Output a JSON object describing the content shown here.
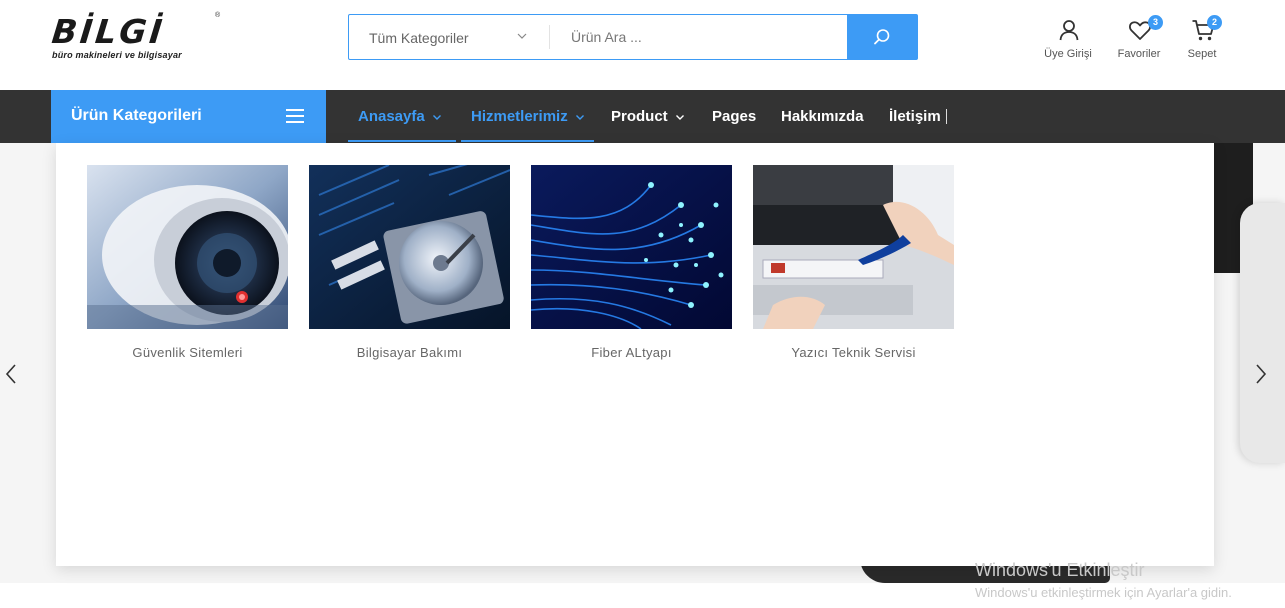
{
  "header": {
    "logo": {
      "word": "BİLGİ",
      "registered": "®",
      "tagline": "büro makineleri ve bilgisayar"
    },
    "search": {
      "category_label": "Tüm Kategoriler",
      "placeholder": "Ürün Ara ..."
    },
    "actions": [
      {
        "label": "Üye Girişi",
        "icon": "user-icon"
      },
      {
        "label": "Favoriler",
        "icon": "heart-icon",
        "badge": "3"
      },
      {
        "label": "Sepet",
        "icon": "cart-icon",
        "badge": "2"
      }
    ]
  },
  "nav": {
    "categories_label": "Ürün Kategorileri",
    "items": [
      {
        "label": "Anasayfa",
        "has_dropdown": true,
        "active": true
      },
      {
        "label": "Hizmetlerimiz",
        "has_dropdown": true,
        "active": true
      },
      {
        "label": "Product",
        "has_dropdown": true,
        "active": false
      },
      {
        "label": "Pages",
        "has_dropdown": false,
        "active": false
      },
      {
        "label": "Hakkımızda",
        "has_dropdown": false,
        "active": false
      },
      {
        "label": "İletişim",
        "has_dropdown": false,
        "active": false
      }
    ]
  },
  "dropdown": {
    "cards": [
      {
        "caption": "Güvenlik Sitemleri",
        "image": "security-camera"
      },
      {
        "caption": "Bilgisayar Bakımı",
        "image": "hard-drive-motherboard"
      },
      {
        "caption": "Fiber ALtyapı",
        "image": "fiber-optic-cables"
      },
      {
        "caption": "Yazıcı Teknik Servisi",
        "image": "printer-repair"
      }
    ]
  },
  "watermark": {
    "title": "Windows'u Etkinleştir",
    "subtitle": "Windows'u etkinleştirmek için Ayarlar'a gidin."
  },
  "colors": {
    "accent": "#3d9bf5",
    "navbar": "#333333",
    "text_muted": "#666666"
  }
}
